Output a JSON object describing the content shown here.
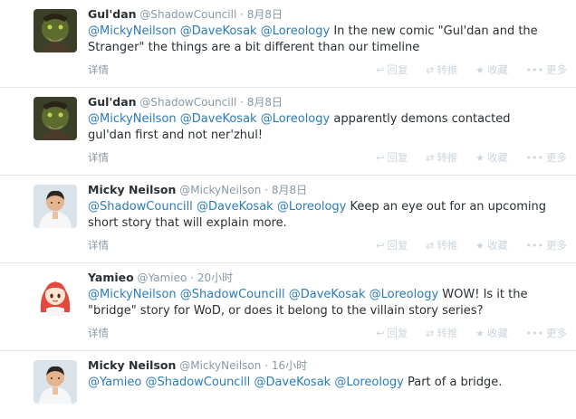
{
  "tweets": [
    {
      "name": "Gul'dan",
      "handle": "@ShadowCouncill",
      "time": "8月8日",
      "segments": [
        {
          "text": "@MickyNeilson",
          "mention": true
        },
        {
          "text": " ",
          "mention": false
        },
        {
          "text": "@DaveKosak",
          "mention": true
        },
        {
          "text": " ",
          "mention": false
        },
        {
          "text": "@Loreology",
          "mention": true
        },
        {
          "text": " In the new comic \"Gul'dan and the Stranger\" the things are a bit different than our timeline",
          "mention": false
        }
      ],
      "avatar": "orc"
    },
    {
      "name": "Gul'dan",
      "handle": "@ShadowCouncill",
      "time": "8月8日",
      "segments": [
        {
          "text": "@MickyNeilson",
          "mention": true
        },
        {
          "text": " ",
          "mention": false
        },
        {
          "text": "@DaveKosak",
          "mention": true
        },
        {
          "text": " ",
          "mention": false
        },
        {
          "text": "@Loreology",
          "mention": true
        },
        {
          "text": " apparently demons contacted gul'dan first and not ner'zhul!",
          "mention": false
        }
      ],
      "avatar": "orc"
    },
    {
      "name": "Micky Neilson",
      "handle": "@MickyNeilson",
      "time": "8月8日",
      "segments": [
        {
          "text": "@ShadowCouncill",
          "mention": true
        },
        {
          "text": " ",
          "mention": false
        },
        {
          "text": "@DaveKosak",
          "mention": true
        },
        {
          "text": " ",
          "mention": false
        },
        {
          "text": "@Loreology",
          "mention": true
        },
        {
          "text": " Keep an eye out for an upcoming short story that will explain more.",
          "mention": false
        }
      ],
      "avatar": "man"
    },
    {
      "name": "Yamieo",
      "handle": "@Yamieo",
      "time": "20小时",
      "segments": [
        {
          "text": "@MickyNeilson",
          "mention": true
        },
        {
          "text": " ",
          "mention": false
        },
        {
          "text": "@ShadowCouncill",
          "mention": true
        },
        {
          "text": " ",
          "mention": false
        },
        {
          "text": "@DaveKosak",
          "mention": true
        },
        {
          "text": " ",
          "mention": false
        },
        {
          "text": "@Loreology",
          "mention": true
        },
        {
          "text": " WOW! Is it the \"bridge\" story for WoD, or does it belong to the villain story series?",
          "mention": false
        }
      ],
      "avatar": "anime"
    },
    {
      "name": "Micky Neilson",
      "handle": "@MickyNeilson",
      "time": "16小时",
      "segments": [
        {
          "text": "@Yamieo",
          "mention": true
        },
        {
          "text": " ",
          "mention": false
        },
        {
          "text": "@ShadowCouncill",
          "mention": true
        },
        {
          "text": " ",
          "mention": false
        },
        {
          "text": "@DaveKosak",
          "mention": true
        },
        {
          "text": " ",
          "mention": false
        },
        {
          "text": "@Loreology",
          "mention": true
        },
        {
          "text": " Part of a bridge.",
          "mention": false
        }
      ],
      "avatar": "man"
    }
  ],
  "labels": {
    "details": "详情",
    "reply": "回复",
    "retweet": "转推",
    "favorite": "收藏",
    "more": "更多",
    "dot": "·"
  },
  "icons": {
    "reply": "reply-icon",
    "retweet": "retweet-icon",
    "favorite": "star-icon",
    "more": "more-icon"
  },
  "colors": {
    "mention": "#2b7bb9",
    "meta": "#8899a6",
    "action": "#ccd6dd",
    "divider": "#e1e8ed"
  }
}
